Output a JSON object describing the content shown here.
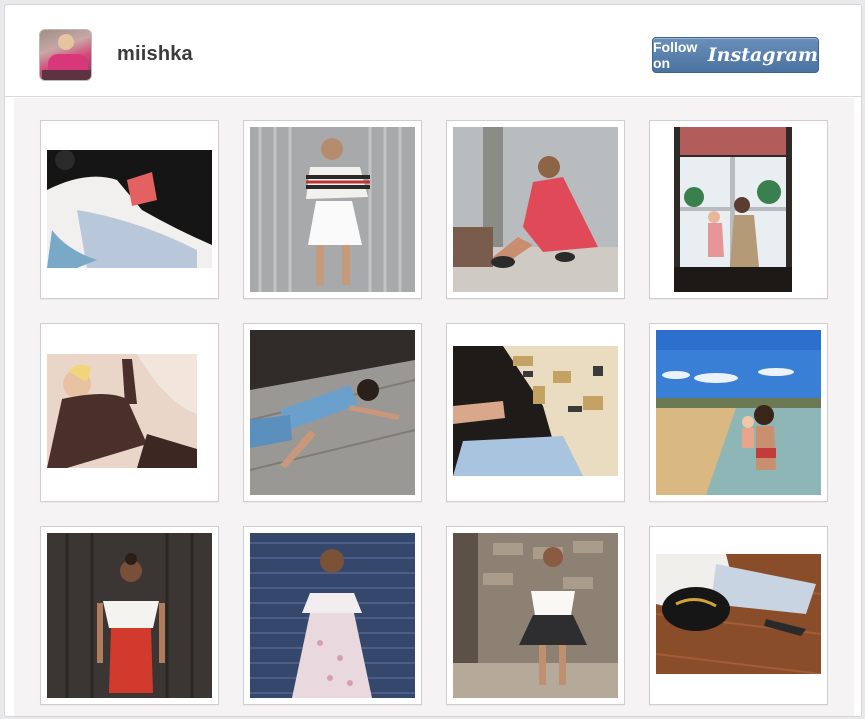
{
  "profile": {
    "username": "miishka",
    "avatar_icon": "profile-avatar"
  },
  "follow_button": {
    "prefix": "Follow on",
    "brand": "Instagram"
  },
  "colors": {
    "button_top": "#6a8fba",
    "button_bottom": "#4b73a1",
    "grid_background": "#f5f3f4"
  },
  "photos": [
    {
      "id": 1,
      "subject": "woman-white-top-watermelon"
    },
    {
      "id": 2,
      "subject": "woman-striped-offshoulder-top"
    },
    {
      "id": 3,
      "subject": "woman-red-dress-sitting"
    },
    {
      "id": 4,
      "subject": "woman-child-window"
    },
    {
      "id": 5,
      "subject": "woman-sheer-top-lying"
    },
    {
      "id": 6,
      "subject": "woman-denim-lying-pavement"
    },
    {
      "id": 7,
      "subject": "woman-embroidered-jacket"
    },
    {
      "id": 8,
      "subject": "woman-child-beach"
    },
    {
      "id": 9,
      "subject": "woman-red-skirt-wall"
    },
    {
      "id": 10,
      "subject": "woman-floral-dress-shutter"
    },
    {
      "id": 11,
      "subject": "woman-black-skirt-brick"
    },
    {
      "id": 12,
      "subject": "legs-cap-floor"
    }
  ]
}
